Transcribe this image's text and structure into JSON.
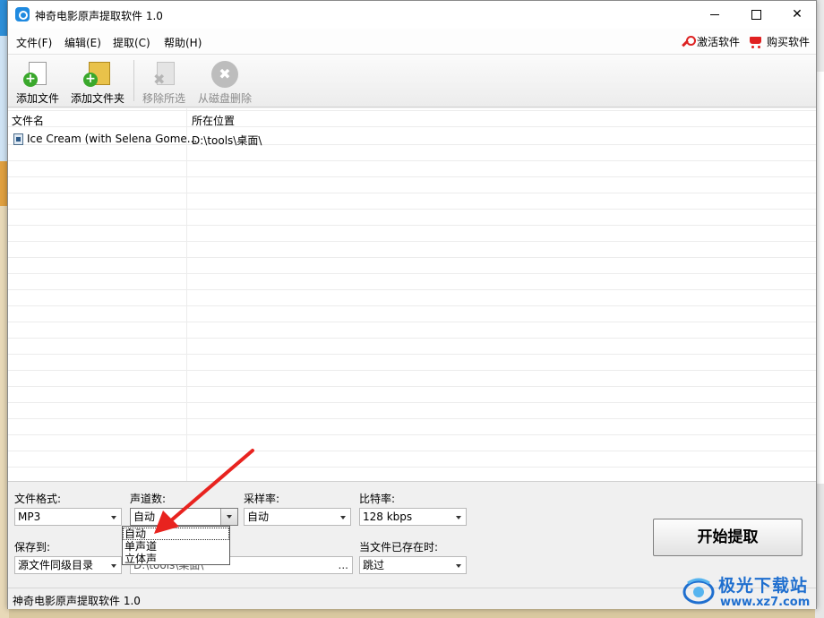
{
  "window": {
    "title": "神奇电影原声提取软件 1.0"
  },
  "menu": {
    "items": [
      "文件(F)",
      "编辑(E)",
      "提取(C)",
      "帮助(H)"
    ],
    "activate": "激活软件",
    "buy": "购买软件"
  },
  "toolbar": {
    "add_file": "添加文件",
    "add_folder": "添加文件夹",
    "remove_selected": "移除所选",
    "delete_from_disk": "从磁盘删除"
  },
  "file_list": {
    "columns": [
      "文件名",
      "所在位置"
    ],
    "rows": [
      {
        "name": "Ice Cream (with Selena Gome...",
        "location": "D:\\tools\\桌面\\"
      }
    ]
  },
  "settings": {
    "format_label": "文件格式:",
    "format_value": "MP3",
    "channels_label": "声道数:",
    "channels_value": "自动",
    "channels_options": [
      "自动",
      "单声道",
      "立体声"
    ],
    "sample_rate_label": "采样率:",
    "sample_rate_value": "自动",
    "bitrate_label": "比特率:",
    "bitrate_value": "128 kbps",
    "save_to_label": "保存到:",
    "save_to_value": "源文件同级目录",
    "save_path": "D:\\tools\\桌面\\",
    "path_browse": "...",
    "exists_label": "当文件已存在时:",
    "exists_value": "跳过",
    "start_button": "开始提取"
  },
  "status": {
    "text": "神奇电影原声提取软件 1.0"
  },
  "watermark": {
    "name": "极光下载站",
    "url": "www.xz7.com"
  },
  "colors": {
    "annotation_arrow": "#e8231f",
    "watermark_blue": "#1f6fcf"
  }
}
